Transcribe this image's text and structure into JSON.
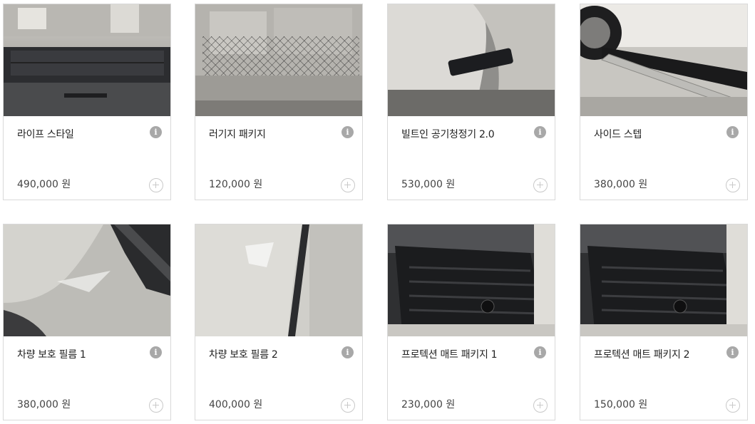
{
  "products": [
    {
      "name": "라이프 스타일",
      "price": "490,000 원",
      "image": "cargo-tray-image"
    },
    {
      "name": "러기지 패키지",
      "price": "120,000 원",
      "image": "luggage-net-image"
    },
    {
      "name": "빌트인 공기청정기 2.0",
      "price": "530,000 원",
      "image": "air-purifier-image"
    },
    {
      "name": "사이드 스텝",
      "price": "380,000 원",
      "image": "side-step-image"
    },
    {
      "name": "차량 보호 필름 1",
      "price": "380,000 원",
      "image": "protection-film-image"
    },
    {
      "name": "차량 보호 필름 2",
      "price": "400,000 원",
      "image": "protection-film-image"
    },
    {
      "name": "프로텍션 매트 패키지 1",
      "price": "230,000 원",
      "image": "floor-mat-image"
    },
    {
      "name": "프로텍션 매트 패키지 2",
      "price": "150,000 원",
      "image": "floor-mat-image"
    }
  ],
  "icons": {
    "info": "i",
    "add": "plus-circle-icon"
  },
  "colors": {
    "border": "#d9d9d9",
    "info_icon": "#a8a8a8",
    "add_icon": "#c9c9c9",
    "text": "#222222"
  }
}
